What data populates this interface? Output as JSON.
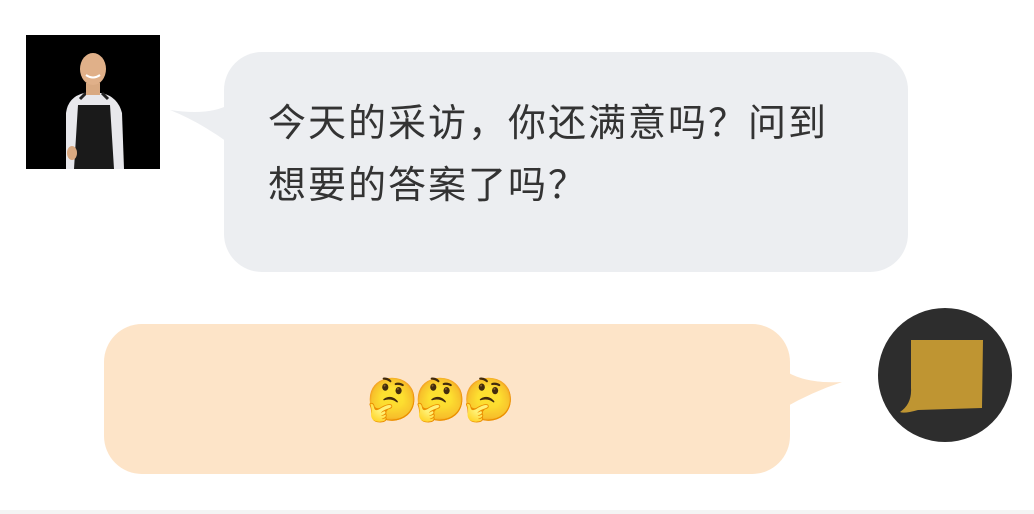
{
  "conversation": {
    "incoming": {
      "avatar_icon": "chef-portrait-avatar",
      "message": "今天的采访，你还满意吗？问到想要的答案了吗？",
      "bubble_color": "#eceef1"
    },
    "outgoing": {
      "avatar_icon": "gold-note-avatar",
      "message": "🤔🤔🤔",
      "bubble_color": "#fde4c8"
    }
  }
}
